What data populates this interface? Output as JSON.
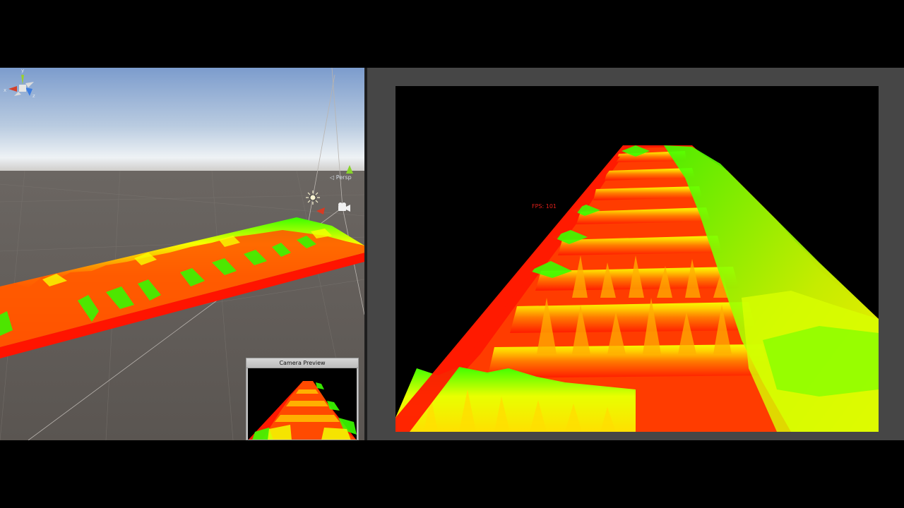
{
  "scene_view": {
    "gizmo": {
      "axis_x": "x",
      "axis_y": "y",
      "axis_z": "z",
      "projection_label": "◁ Persp"
    },
    "icons": [
      "sun-light-icon",
      "camera-icon",
      "scene-gizmo-icon"
    ]
  },
  "camera_preview": {
    "title": "Camera Preview"
  },
  "game_view": {
    "fps_text": "FPS: 101"
  },
  "colors": {
    "spectrum_red": "#ff1a00",
    "spectrum_orange": "#ff8a00",
    "spectrum_yellow": "#f4ff00",
    "spectrum_green": "#3cff00",
    "sky_top": "#7f9fcf",
    "ground": "#5f5a56",
    "game_bg": "#464646"
  }
}
